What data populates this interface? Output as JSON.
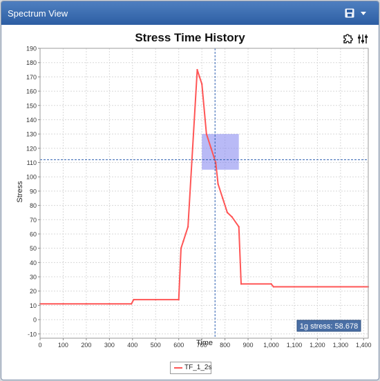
{
  "window": {
    "title": "Spectrum View",
    "save_icon": "floppy-disk-icon",
    "menu_icon": "chevron-down-icon"
  },
  "toolbar": {
    "settings_icon": "puzzle-gear-icon",
    "adjust_icon": "sliders-icon"
  },
  "colors": {
    "series": "#ff5555",
    "crosshair": "#2a5db0",
    "selection": "#8a8cf0",
    "badge_bg": "#4a6fa5"
  },
  "readout": {
    "label": "1g stress: 58.678"
  },
  "chart_data": {
    "type": "line",
    "title": "Stress Time History",
    "xlabel": "Time",
    "ylabel": "Stress",
    "xlim": [
      0,
      1420
    ],
    "ylim": [
      -13,
      190
    ],
    "x_ticks": [
      0,
      100,
      200,
      300,
      400,
      500,
      600,
      700,
      800,
      900,
      1000,
      1100,
      1200,
      1300,
      1400
    ],
    "x_tick_labels": [
      "0",
      "100",
      "200",
      "300",
      "400",
      "500",
      "600",
      "700",
      "800",
      "900",
      "1,000",
      "1,100",
      "1,200",
      "1,300",
      "1,400"
    ],
    "y_ticks": [
      -10,
      0,
      10,
      20,
      30,
      40,
      50,
      60,
      70,
      80,
      90,
      100,
      110,
      120,
      130,
      140,
      150,
      160,
      170,
      180,
      190
    ],
    "y_tick_labels": [
      "-10",
      "0",
      "10",
      "20",
      "30",
      "40",
      "50",
      "60",
      "70",
      "80",
      "90",
      "100",
      "110",
      "120",
      "130",
      "140",
      "150",
      "160",
      "170",
      "180",
      "190"
    ],
    "grid": true,
    "legend_position": "bottom-center",
    "crosshair": {
      "x": 757,
      "y": 112
    },
    "selection_range": {
      "x": [
        700,
        860
      ],
      "y": [
        105,
        130
      ]
    },
    "series": [
      {
        "name": "TF_1_2s",
        "x": [
          0,
          100,
          200,
          300,
          395,
          405,
          500,
          600,
          610,
          620,
          640,
          660,
          680,
          690,
          700,
          720,
          740,
          760,
          770,
          790,
          810,
          830,
          860,
          870,
          1000,
          1010,
          1100,
          1200,
          1300,
          1420
        ],
        "y": [
          11,
          11,
          11,
          11,
          11,
          14,
          14,
          14,
          50,
          55,
          65,
          120,
          175,
          170,
          165,
          130,
          120,
          110,
          95,
          85,
          75,
          72,
          65,
          25,
          25,
          23,
          23,
          23,
          23,
          23
        ]
      }
    ]
  }
}
